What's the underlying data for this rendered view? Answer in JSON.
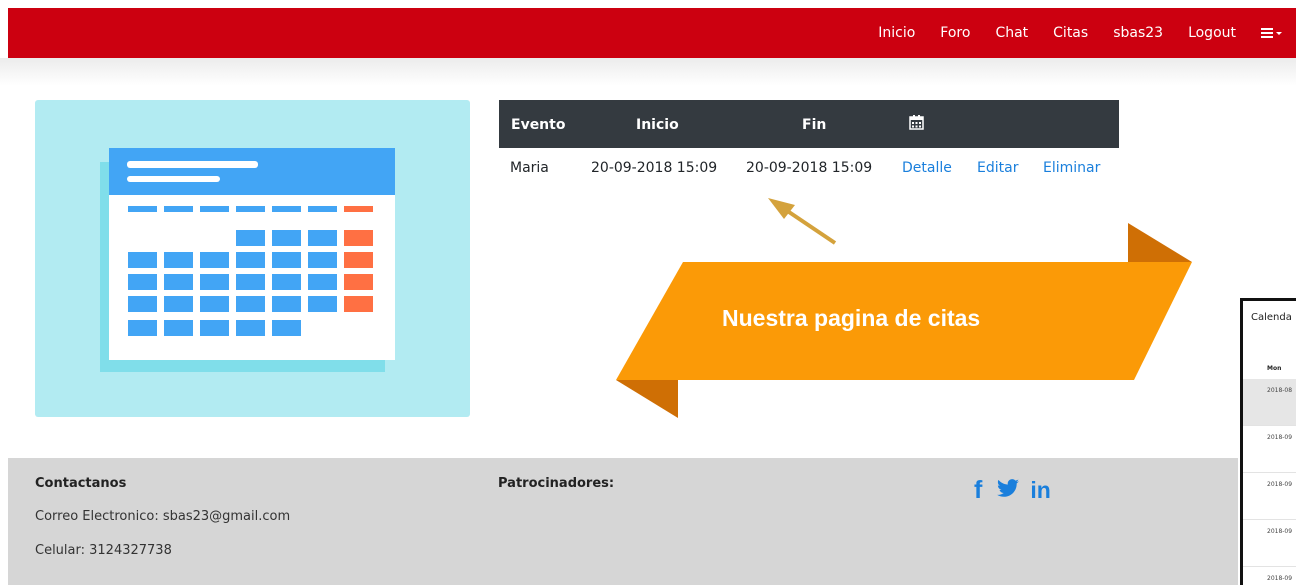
{
  "nav": {
    "items": [
      "Inicio",
      "Foro",
      "Chat",
      "Citas",
      "sbas23",
      "Logout"
    ],
    "menu_icon": "hamburger-dropdown-icon"
  },
  "illustration": {
    "icon": "calendar-illustration"
  },
  "table": {
    "headers": {
      "evento": "Evento",
      "inicio": "Inicio",
      "fin": "Fin",
      "calendar_icon": "calendar-icon"
    },
    "row": {
      "evento": "Maria",
      "inicio": "20-09-2018 15:09",
      "fin": "20-09-2018 15:09",
      "detalle": "Detalle",
      "editar": "Editar",
      "eliminar": "Eliminar"
    }
  },
  "callout": {
    "text": "Nuestra pagina de citas"
  },
  "side_panel": {
    "title": "Calenda",
    "col_label": "Mon",
    "rows": [
      "2018-08",
      "2018-09",
      "2018-09",
      "2018-09",
      "2018-09"
    ]
  },
  "footer": {
    "contact_title": "Contactanos",
    "email_line": "Correo Electronico: sbas23@gmail.com",
    "phone_line": "Celular: 3124327738",
    "sponsors_title": "Patrocinadores:",
    "social": {
      "facebook": "f",
      "twitter": "twitter-icon",
      "linkedin": "in"
    }
  },
  "colors": {
    "navbar": "#cc0010",
    "table_header": "#343a40",
    "link": "#1a7fdc",
    "callout": "#fb9a07",
    "callout_fold": "#cf6f05",
    "illustration_bg": "#b2ebf2",
    "footer": "#d6d6d6"
  }
}
